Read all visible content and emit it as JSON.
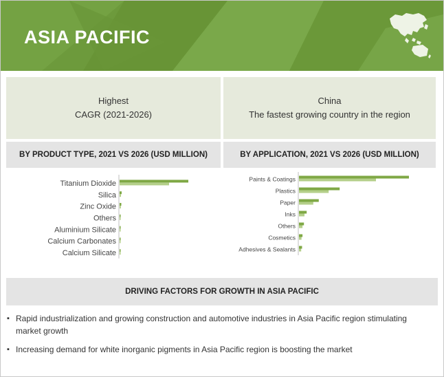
{
  "header": {
    "title": "ASIA PACIFIC",
    "map_icon": "asia-pacific-map-icon"
  },
  "highlight_left": {
    "line1": "Highest",
    "line2": "CAGR (2021-2026)"
  },
  "highlight_right": {
    "line1": "China",
    "line2": "The fastest growing country in the region"
  },
  "product_section": {
    "label": "BY PRODUCT TYPE, 2021 VS 2026 (USD MILLION)"
  },
  "application_section": {
    "label": "BY APPLICATION, 2021 VS 2026 (USD MILLION)"
  },
  "chart_data": [
    {
      "type": "bar",
      "orientation": "horizontal",
      "categories": [
        "Titanium Dioxide",
        "Silica",
        "Zinc Oxide",
        "Others",
        "Aluminium Silicate",
        "Calcium Carbonates",
        "Calcium Silicate"
      ],
      "series": [
        {
          "values": [
            100,
            3,
            2.5,
            0.8,
            0.6,
            0.5,
            0.4
          ]
        },
        {
          "values": [
            72,
            2,
            1.8,
            0.6,
            0.4,
            0.4,
            0.3
          ]
        }
      ],
      "colors": [
        "#7fa845",
        "#b4cf8a"
      ],
      "xlim": [
        0,
        100
      ]
    },
    {
      "type": "bar",
      "orientation": "horizontal",
      "categories": [
        "Paints & Coatings",
        "Plastics",
        "Paper",
        "Inks",
        "Others",
        "Cosmetics",
        "Adhesives & Sealants"
      ],
      "series": [
        {
          "values": [
            100,
            37,
            18,
            7,
            4.5,
            3.2,
            2.8
          ]
        },
        {
          "values": [
            70,
            27,
            13,
            5,
            3.2,
            2.3,
            2
          ]
        }
      ],
      "colors": [
        "#7fa845",
        "#b4cf8a"
      ],
      "xlim": [
        0,
        100
      ]
    }
  ],
  "driving": {
    "title": "DRIVING FACTORS FOR GROWTH IN ASIA PACIFIC",
    "items": [
      "Rapid industrialization and growing construction and automotive industries in Asia Pacific region stimulating market growth",
      "Increasing demand for white inorganic pigments in Asia Pacific region is boosting the market"
    ]
  }
}
